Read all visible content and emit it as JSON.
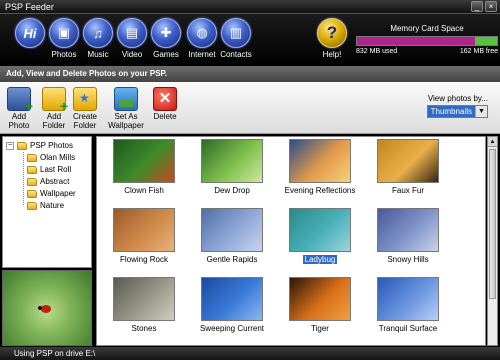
{
  "window": {
    "title": "PSP Feeder"
  },
  "nav": {
    "hi": "Hi",
    "items": [
      {
        "label": "Photos",
        "icon": "camera-icon"
      },
      {
        "label": "Music",
        "icon": "music-note-icon"
      },
      {
        "label": "Video",
        "icon": "film-icon"
      },
      {
        "label": "Games",
        "icon": "gamepad-icon"
      },
      {
        "label": "Internet",
        "icon": "globe-icon"
      },
      {
        "label": "Contacts",
        "icon": "contacts-icon"
      }
    ],
    "help_glyph": "?",
    "help_label": "Help!"
  },
  "memory_card": {
    "title": "Memory Card Space",
    "used": "832 MB used",
    "free": "162 MB free",
    "used_fraction": 0.84,
    "used_color": "#b0248f",
    "free_color": "#5ac040"
  },
  "subheader": "Add, View and Delete Photos on your PSP.",
  "toolbar": {
    "add_photo": "Add\nPhoto",
    "add_folder": "Add\nFolder",
    "create_folder": "Create\nFolder",
    "set_wallpaper": "Set As\nWallpaper",
    "delete": "Delete",
    "delete_glyph": "✕",
    "view_label": "View photos by...",
    "view_value": "Thumbnails",
    "view_arrow": "▼"
  },
  "tree": {
    "expander": "−",
    "root": "PSP Photos",
    "folders": [
      "Olan Mills",
      "Last Roll",
      "Abstract",
      "Wallpaper",
      "Nature"
    ]
  },
  "photos": [
    {
      "caption": "Clown Fish",
      "colors": [
        "#1f5a1f",
        "#3f8a2a",
        "#c94a22"
      ]
    },
    {
      "caption": "Dew Drop",
      "colors": [
        "#2f6a2a",
        "#7fbf4a",
        "#cfe8a0"
      ]
    },
    {
      "caption": "Evening Reflections",
      "colors": [
        "#2b4e8a",
        "#e39a4a",
        "#f6d27a"
      ]
    },
    {
      "caption": "Faux Fur",
      "colors": [
        "#c4861e",
        "#e8b04a",
        "#3a2410"
      ]
    },
    {
      "caption": "Flowing Rock",
      "colors": [
        "#9a5a2a",
        "#d08a4a",
        "#e9b27a"
      ]
    },
    {
      "caption": "Gentle Rapids",
      "colors": [
        "#5070a8",
        "#90a8d8",
        "#c8d4ee"
      ]
    },
    {
      "caption": "Ladybug",
      "colors": [
        "#2a8a8a",
        "#4ab0b8",
        "#9ad6dc"
      ],
      "selected": true
    },
    {
      "caption": "Snowy Hills",
      "colors": [
        "#4a5a9a",
        "#8094c8",
        "#cbd3ec"
      ]
    },
    {
      "caption": "Stones",
      "colors": [
        "#5a5a52",
        "#9a9888",
        "#d0cebe"
      ]
    },
    {
      "caption": "Sweeping Current",
      "colors": [
        "#1a4aa0",
        "#3a7ad8",
        "#8ab8f0"
      ]
    },
    {
      "caption": "Tiger",
      "colors": [
        "#2a1608",
        "#d8701a",
        "#f0a040"
      ]
    },
    {
      "caption": "Tranquil Surface",
      "colors": [
        "#2a5ab8",
        "#6a94e0",
        "#b8d0f4"
      ]
    }
  ],
  "scroll": {
    "up": "▲"
  },
  "status": "Using PSP on drive E:\\"
}
